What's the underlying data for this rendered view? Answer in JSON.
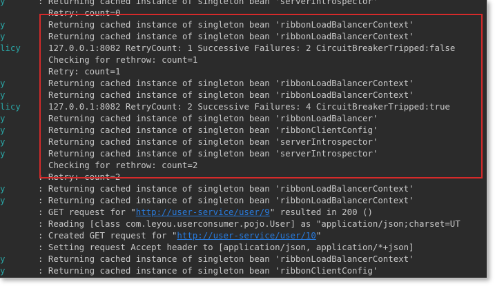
{
  "colors": {
    "background": "#2b2b2b",
    "text": "#c8c8c8",
    "logger": "#2aa6a6",
    "link": "#287bde",
    "highlight_border": "#d62a2a"
  },
  "lines": [
    {
      "logger": "y",
      "prefix": ": ",
      "text": "Returning cached instance of singleton bean 'serverIntrospector'"
    },
    {
      "logger": "",
      "prefix": "",
      "text": "Retry: count=0"
    },
    {
      "logger": "y",
      "prefix": "",
      "text": "Returning cached instance of singleton bean 'ribbonLoadBalancerContext'"
    },
    {
      "logger": "y",
      "prefix": "",
      "text": "Returning cached instance of singleton bean 'ribbonLoadBalancerContext'"
    },
    {
      "logger": "licy",
      "prefix": "",
      "text": "127.0.0.1:8082 RetryCount: 1 Successive Failures: 2 CircuitBreakerTripped:false"
    },
    {
      "logger": "",
      "prefix": "",
      "text": "Checking for rethrow: count=1"
    },
    {
      "logger": "",
      "prefix": "",
      "text": "Retry: count=1"
    },
    {
      "logger": "y",
      "prefix": "",
      "text": "Returning cached instance of singleton bean 'ribbonLoadBalancerContext'"
    },
    {
      "logger": "y",
      "prefix": "",
      "text": "Returning cached instance of singleton bean 'ribbonLoadBalancerContext'"
    },
    {
      "logger": "licy",
      "prefix": "",
      "text": "127.0.0.1:8082 RetryCount: 2 Successive Failures: 4 CircuitBreakerTripped:true"
    },
    {
      "logger": "y",
      "prefix": "",
      "text": "Returning cached instance of singleton bean 'ribbonLoadBalancer'"
    },
    {
      "logger": "y",
      "prefix": "",
      "text": "Returning cached instance of singleton bean 'ribbonClientConfig'"
    },
    {
      "logger": "y",
      "prefix": "",
      "text": "Returning cached instance of singleton bean 'serverIntrospector'"
    },
    {
      "logger": "y",
      "prefix": "",
      "text": "Returning cached instance of singleton bean 'serverIntrospector'"
    },
    {
      "logger": "",
      "prefix": "",
      "text": "Checking for rethrow: count=2"
    },
    {
      "logger": "",
      "prefix": ": ",
      "text": "Retry: count=2"
    },
    {
      "logger": "y",
      "prefix": ": ",
      "text": "Returning cached instance of singleton bean 'ribbonLoadBalancerContext'"
    },
    {
      "logger": "y",
      "prefix": ": ",
      "text": "Returning cached instance of singleton bean 'ribbonLoadBalancerContext'"
    },
    {
      "logger": "",
      "prefix": ": ",
      "text": "GET request for \"",
      "link": "http://user-service/user/9",
      "suffix": "\" resulted in 200 ()"
    },
    {
      "logger": "",
      "prefix": ": ",
      "text": "Reading [class com.leyou.userconsumer.pojo.User] as \"application/json;charset=UT"
    },
    {
      "logger": "",
      "prefix": ": ",
      "text": "Created GET request for \"",
      "link": "http://user-service/user/10",
      "suffix": "\""
    },
    {
      "logger": "",
      "prefix": ": ",
      "text": "Setting request Accept header to [application/json, application/*+json]"
    },
    {
      "logger": "y",
      "prefix": ": ",
      "text": "Returning cached instance of singleton bean 'ribbonLoadBalancerContext'"
    },
    {
      "logger": "y",
      "prefix": ": ",
      "text": "Returning cached instance of singleton bean 'ribbonClientConfig'"
    }
  ]
}
